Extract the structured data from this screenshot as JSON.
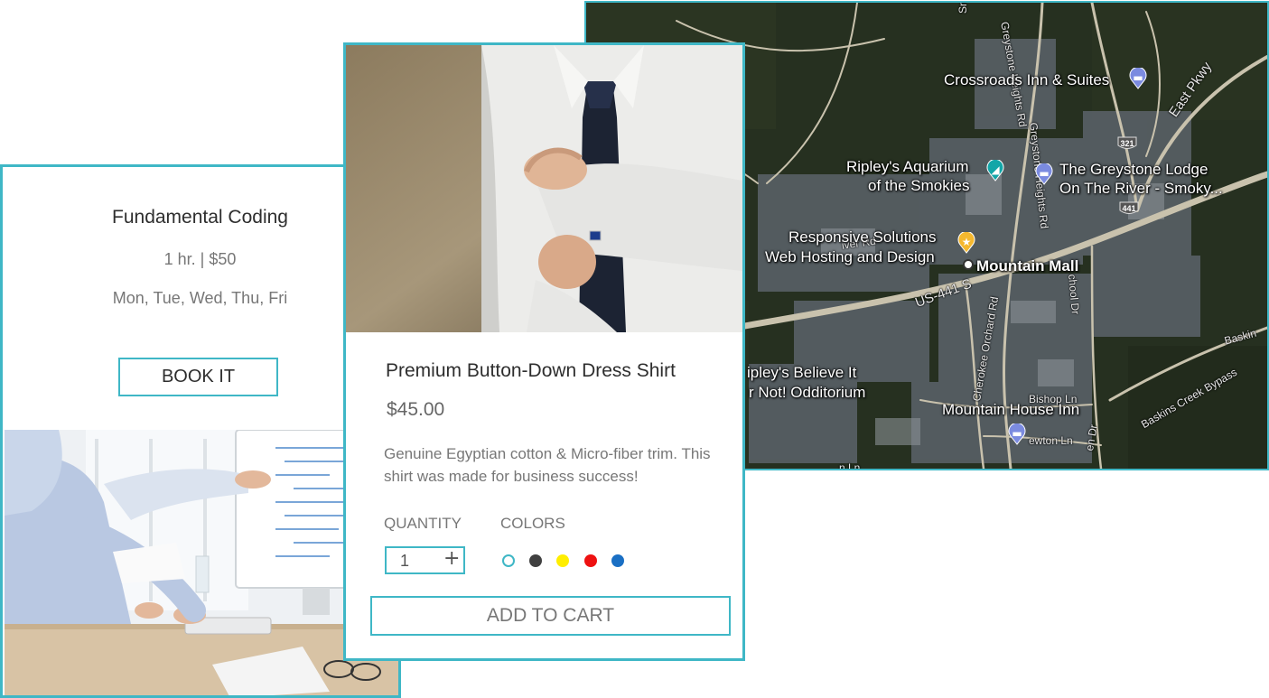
{
  "course": {
    "title": "Fundamental Coding",
    "meta": "1 hr. | $50",
    "days": "Mon, Tue, Wed, Thu, Fri",
    "button_label": "BOOK IT"
  },
  "product": {
    "title": "Premium Button-Down Dress Shirt",
    "price": "$45.00",
    "description": "Genuine Egyptian cotton & Micro-fiber trim. This shirt was made for business success!",
    "quantity_label": "QUANTITY",
    "quantity_value": "1",
    "plus_symbol": "+",
    "colors_label": "COLORS",
    "swatches": [
      "#ffffff",
      "#404040",
      "#ffee00",
      "#ee1111",
      "#1a6fc4"
    ],
    "selected_swatch_ring": "#3fb7c6",
    "button_label": "ADD TO CART"
  },
  "map": {
    "places": {
      "crossroads": "Crossroads Inn & Suites",
      "aquarium_line1": "Ripley's Aquarium",
      "aquarium_line2": "of the Smokies",
      "greystone_line1": "The Greystone Lodge",
      "greystone_line2": "On The River - Smoky...",
      "responsive_line1": "Responsive Solutions",
      "responsive_line2": "Web Hosting and Design",
      "mall": "Mountain Mall",
      "believe_line1": "ipley's Believe It",
      "believe_line2": "r Not! Odditorium",
      "mountain_house": "Mountain House Inn"
    },
    "streets": {
      "greystone_heights": "Greystone Heights Rd",
      "east_pkwy": "East Pkwy",
      "us441": "US-441 S",
      "cherokee_orchard": "Cherokee Orchard Rd",
      "bishop": "Bishop Ln",
      "newton": "ewton Ln",
      "school": "chool Dr",
      "baskins": "Baskins Creek Bypass",
      "baskin_right": "Baskin",
      "river": "iver Rd",
      "ln_bottom": "n Ln",
      "en_dr": "en Dr",
      "smoky_top": "Smok"
    },
    "shields": [
      "321",
      "441"
    ],
    "colors": {
      "hotel_pin": "#7b8be0",
      "aquarium_pin": "#13a6a8",
      "business_pin": "#f5b82e"
    }
  }
}
